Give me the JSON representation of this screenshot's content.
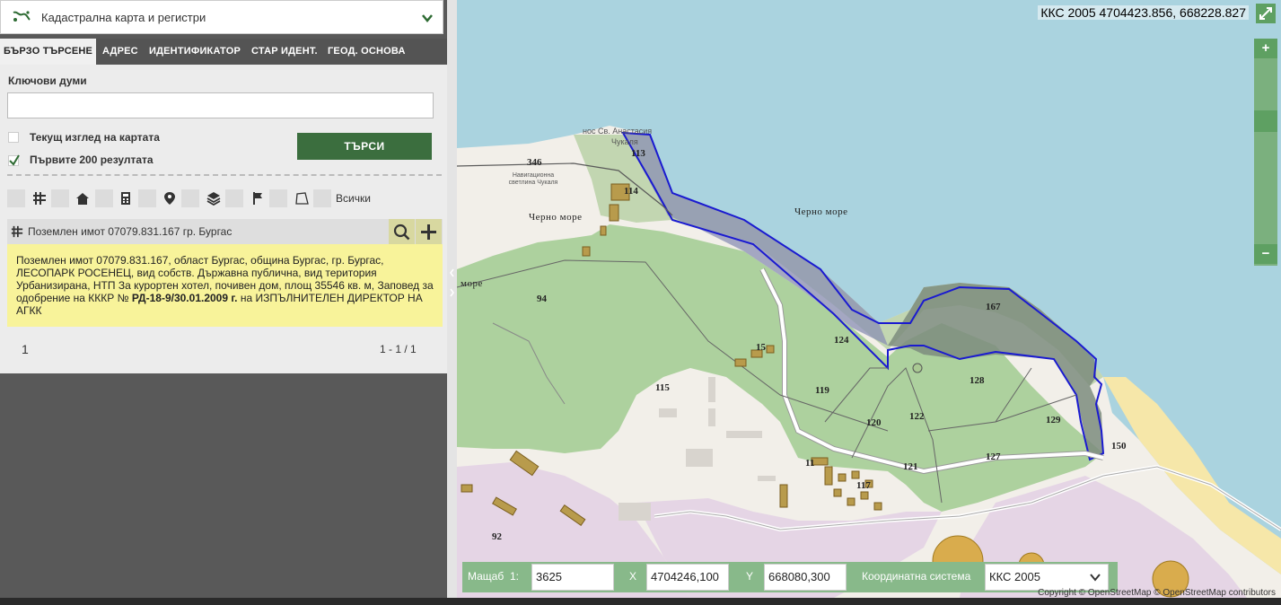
{
  "header": {
    "title": "Кадастрална карта и регистри"
  },
  "tabs": [
    {
      "label": "БЪРЗО ТЪРСЕНЕ",
      "active": true
    },
    {
      "label": "АДРЕС"
    },
    {
      "label": "ИДЕНТИФИКАТОР"
    },
    {
      "label": "СТАР ИДЕНТ."
    },
    {
      "label": "ГЕОД. ОСНОВА"
    }
  ],
  "search": {
    "keywords_label": "Ключови думи",
    "keywords_value": "",
    "current_view_label": "Текущ изглед на картата",
    "current_view_checked": false,
    "first200_label": "Първите 200 резултата",
    "first200_checked": true,
    "button_label": "ТЪРСИ"
  },
  "filters": {
    "all_label": "Всички",
    "icons": [
      "parcel-grid-icon",
      "building-icon",
      "apartment-icon",
      "address-pin-icon",
      "layers-icon",
      "flag-icon",
      "polygon-icon"
    ]
  },
  "result": {
    "title": "Поземлен имот 07079.831.167 гр. Бургас",
    "description_part1": "Поземлен имот 07079.831.167, област Бургас, община Бургас, гр. Бургас, ЛЕСОПАРК РОСЕНЕЦ, вид собств. Държавна публична, вид територия Урбанизирана, НТП За курортен хотел, почивен дом, площ 35546 кв. м, Заповед за одобрение на КККР №",
    "description_bold": "РД-18-9/30.01.2009 г.",
    "description_part2": "на ИЗПЪЛНИТЕЛЕН ДИРЕКТОР НА АГКК"
  },
  "pager": {
    "current": "1",
    "range": "1 - 1 / 1"
  },
  "map": {
    "coords_top": "ККС 2005 4704423.856, 668228.827",
    "zoom_in": "+",
    "zoom_out": "−",
    "sea_labels": [
      "Черно море",
      "Черно море",
      "море"
    ],
    "place_labels": [
      "нос Св. Анастасия",
      "Чукаля",
      "Навигационна светлина Чукаля"
    ],
    "parcel_labels": [
      "113",
      "346",
      "114",
      "94",
      "167",
      "124",
      "15",
      "115",
      "119",
      "128",
      "120",
      "122",
      "129",
      "150",
      "127",
      "121",
      "117",
      "11",
      "92"
    ],
    "copyright": "Copyright © OpenStreetMap © OpenStreetMap contributors"
  },
  "bottombar": {
    "scale_label": "Мащаб",
    "scale_prefix": "1:",
    "scale_value": "3625",
    "x_label": "X",
    "x_value": "4704246,100",
    "y_label": "Y",
    "y_value": "668080,300",
    "crs_label": "Координатна система",
    "crs_value": "ККС 2005"
  }
}
